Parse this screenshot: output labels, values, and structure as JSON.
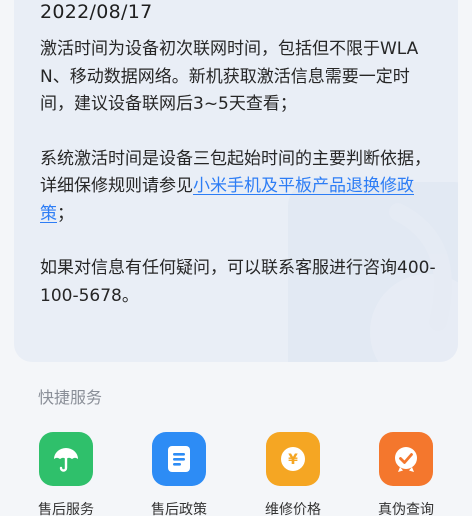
{
  "activation": {
    "date": "2022/08/17",
    "para1": "激活时间为设备初次联网时间，包括但不限于WLAN、移动数据网络。新机获取激活信息需要一定时间，建议设备联网后3~5天查看；",
    "para2_prefix": "系统激活时间是设备三包起始时间的主要判断依据，详细保修规则请参见",
    "para2_link": "小米手机及平板产品退换修政策",
    "para2_suffix": "；",
    "para3": "如果对信息有任何疑问，可以联系客服进行咨询400-100-5678。"
  },
  "quick_services": {
    "title": "快捷服务",
    "items": [
      {
        "label": "售后服务",
        "icon": "umbrella-icon",
        "color": "#2fc06b"
      },
      {
        "label": "售后政策",
        "icon": "document-icon",
        "color": "#2d8cf5"
      },
      {
        "label": "维修价格",
        "icon": "coin-icon",
        "color": "#f5a623"
      },
      {
        "label": "真伪查询",
        "icon": "verify-badge-icon",
        "color": "#f4772d"
      }
    ]
  }
}
